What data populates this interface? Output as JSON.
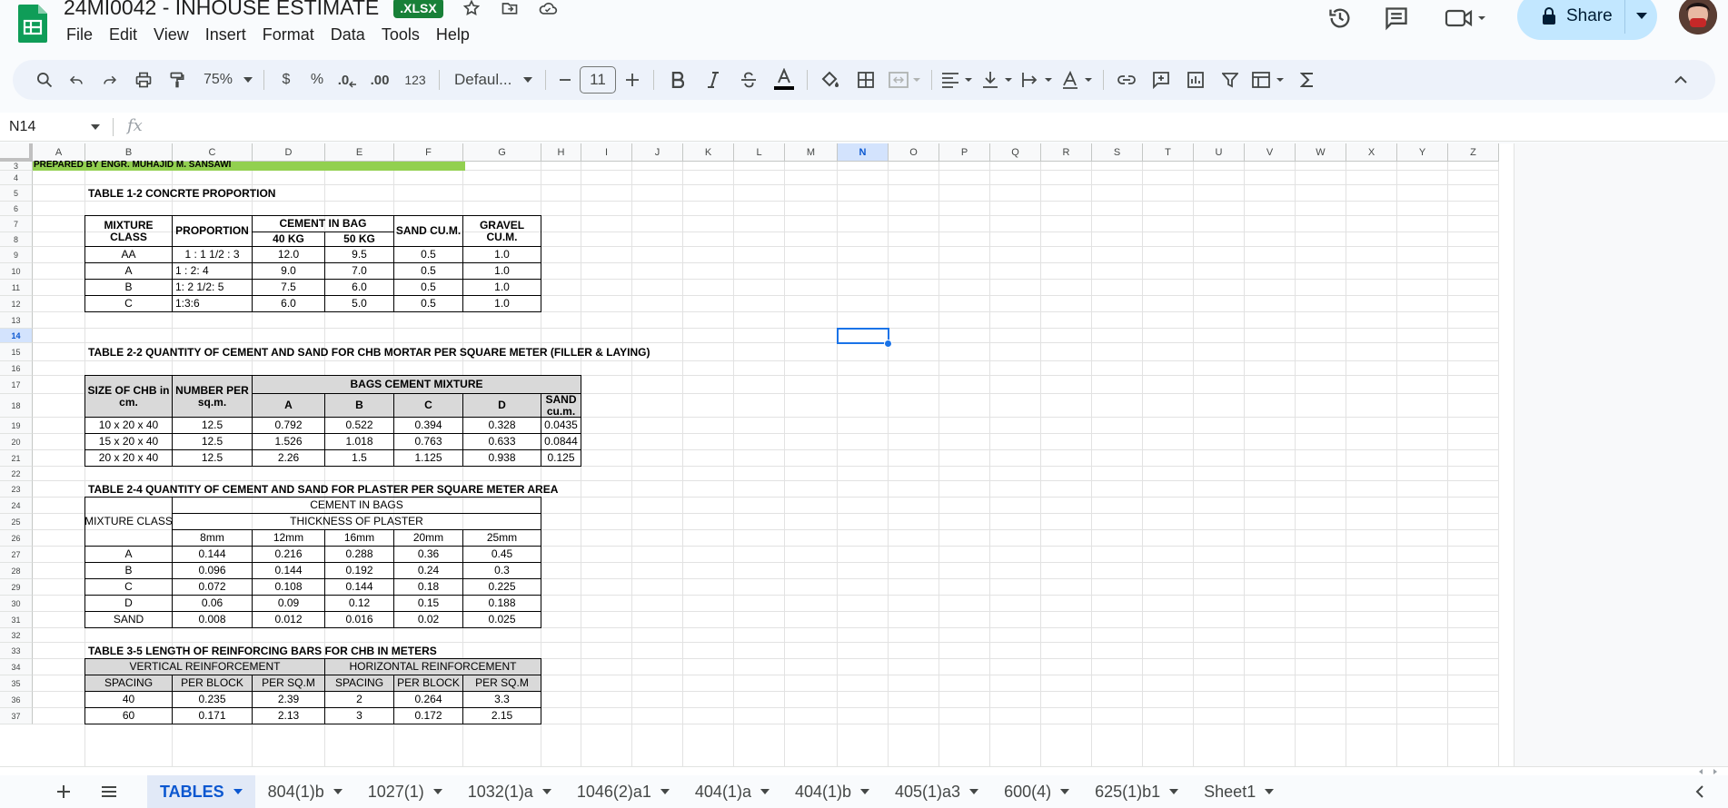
{
  "doc": {
    "title": "24MI0042 - INHOUSE ESTIMATE",
    "badge": ".XLSX"
  },
  "menus": [
    "File",
    "Edit",
    "View",
    "Insert",
    "Format",
    "Data",
    "Tools",
    "Help"
  ],
  "share": {
    "label": "Share"
  },
  "toolbar": {
    "zoom": "75%",
    "currency": "$",
    "percent": "%",
    "dec_decrease": ".0",
    "dec_increase": ".00",
    "number_format": "123",
    "font": "Defaul...",
    "font_size": "11"
  },
  "formula_bar": {
    "cell_ref": "N14",
    "fx": "fx",
    "value": ""
  },
  "colors": {
    "accent": "#1a73e8",
    "green_band": "#92d050",
    "sheets_green": "#188038",
    "share_bg": "#c2e7ff"
  },
  "columns": [
    "A",
    "B",
    "C",
    "D",
    "E",
    "F",
    "G",
    "H",
    "I",
    "J",
    "K",
    "L",
    "M",
    "N",
    "O",
    "P",
    "Q",
    "R",
    "S",
    "T",
    "U",
    "V",
    "W",
    "X",
    "Y",
    "Z"
  ],
  "rows": [
    "3",
    "4",
    "5",
    "6",
    "7",
    "8",
    "9",
    "10",
    "11",
    "12",
    "13",
    "14",
    "15",
    "16",
    "17",
    "18",
    "19",
    "20",
    "21",
    "22",
    "23",
    "24",
    "25",
    "26",
    "27",
    "28",
    "29",
    "30",
    "31",
    "32",
    "33",
    "34",
    "35",
    "36",
    "37"
  ],
  "selected_cell": {
    "col": "N",
    "row": "14"
  },
  "prepared": "PREPARED BY ENGR. MUHAJID M. SANSAWI",
  "table1": {
    "title": "TABLE 1-2 CONCRTE PROPORTION",
    "h_mixture": "MIXTURE CLASS",
    "h_proportion": "PROPORTION",
    "h_cement": "CEMENT IN BAG",
    "h_40": "40 KG",
    "h_50": "50 KG",
    "h_sand": "SAND CU.M.",
    "h_gravel": "GRAVEL CU.M.",
    "rows": [
      [
        "AA",
        "1 : 1 1/2 : 3",
        "12.0",
        "9.5",
        "0.5",
        "1.0"
      ],
      [
        "A",
        "1 : 2: 4",
        "9.0",
        "7.0",
        "0.5",
        "1.0"
      ],
      [
        "B",
        "1: 2 1/2: 5",
        "7.5",
        "6.0",
        "0.5",
        "1.0"
      ],
      [
        "C",
        "1:3:6",
        "6.0",
        "5.0",
        "0.5",
        "1.0"
      ]
    ]
  },
  "table2": {
    "title": "TABLE 2-2 QUANTITY OF CEMENT AND SAND FOR CHB MORTAR PER SQUARE METER (FILLER & LAYING)",
    "h_size": "SIZE OF CHB in cm.",
    "h_number": "NUMBER PER sq.m.",
    "h_bags": "BAGS CEMENT MIXTURE",
    "h_a": "A",
    "h_b": "B",
    "h_c": "C",
    "h_d": "D",
    "h_sand": "SAND cu.m.",
    "rows": [
      [
        "10  x  20  x  40",
        "12.5",
        "0.792",
        "0.522",
        "0.394",
        "0.328",
        "0.0435"
      ],
      [
        "15  x  20  x  40",
        "12.5",
        "1.526",
        "1.018",
        "0.763",
        "0.633",
        "0.0844"
      ],
      [
        "20  x  20  x  40",
        "12.5",
        "2.26",
        "1.5",
        "1.125",
        "0.938",
        "0.125"
      ]
    ]
  },
  "table3": {
    "title": "TABLE 2-4 QUANTITY OF CEMENT AND SAND FOR PLASTER PER SQUARE METER AREA",
    "h_mixture": "MIXTURE CLASS",
    "h_cement": "CEMENT IN BAGS",
    "h_thickness": "THICKNESS OF PLASTER",
    "thicknesses": [
      "8mm",
      "12mm",
      "16mm",
      "20mm",
      "25mm"
    ],
    "rows": [
      [
        "A",
        "0.144",
        "0.216",
        "0.288",
        "0.36",
        "0.45"
      ],
      [
        "B",
        "0.096",
        "0.144",
        "0.192",
        "0.24",
        "0.3"
      ],
      [
        "C",
        "0.072",
        "0.108",
        "0.144",
        "0.18",
        "0.225"
      ],
      [
        "D",
        "0.06",
        "0.09",
        "0.12",
        "0.15",
        "0.188"
      ],
      [
        "SAND",
        "0.008",
        "0.012",
        "0.016",
        "0.02",
        "0.025"
      ]
    ]
  },
  "table4": {
    "title": "TABLE 3-5 LENGTH OF REINFORCING BARS FOR CHB IN METERS",
    "h_vertical": "VERTICAL REINFORCEMENT",
    "h_horizontal": "HORIZONTAL REINFORCEMENT",
    "subheaders": [
      "SPACING",
      "PER BLOCK",
      "PER SQ.M",
      "SPACING",
      "PER BLOCK",
      "PER SQ.M"
    ],
    "rows": [
      [
        "40",
        "0.235",
        "2.39",
        "2",
        "0.264",
        "3.3"
      ],
      [
        "60",
        "0.171",
        "2.13",
        "3",
        "0.172",
        "2.15"
      ]
    ]
  },
  "sheet_tabs": [
    "TABLES",
    "804(1)b",
    "1027(1)",
    "1032(1)a",
    "1046(2)a1",
    "404(1)a",
    "404(1)b",
    "405(1)a3",
    "600(4)",
    "625(1)b1",
    "Sheet1"
  ],
  "active_tab": "TABLES"
}
